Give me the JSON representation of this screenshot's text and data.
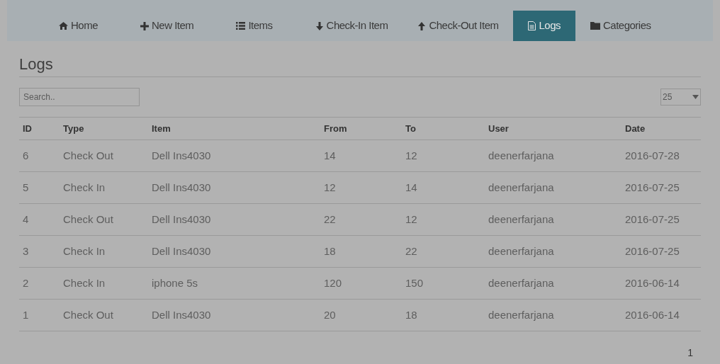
{
  "nav": [
    {
      "label": "Home",
      "selected": false
    },
    {
      "label": "New Item",
      "selected": false
    },
    {
      "label": "Items",
      "selected": false
    },
    {
      "label": "Check-In Item",
      "selected": false
    },
    {
      "label": "Check-Out Item",
      "selected": false
    },
    {
      "label": "Logs",
      "selected": true
    },
    {
      "label": "Categories",
      "selected": false
    }
  ],
  "title": "Logs",
  "search": {
    "placeholder": "Search.."
  },
  "page_size": "25",
  "table": {
    "columns": [
      "ID",
      "Type",
      "Item",
      "From",
      "To",
      "User",
      "Date"
    ],
    "rows": [
      [
        "6",
        "Check Out",
        "Dell Ins4030",
        "14",
        "12",
        "deenerfarjana",
        "2016-07-28"
      ],
      [
        "5",
        "Check In",
        "Dell Ins4030",
        "12",
        "14",
        "deenerfarjana",
        "2016-07-25"
      ],
      [
        "4",
        "Check Out",
        "Dell Ins4030",
        "22",
        "12",
        "deenerfarjana",
        "2016-07-25"
      ],
      [
        "3",
        "Check In",
        "Dell Ins4030",
        "18",
        "22",
        "deenerfarjana",
        "2016-07-25"
      ],
      [
        "2",
        "Check In",
        "iphone 5s",
        "120",
        "150",
        "deenerfarjana",
        "2016-06-14"
      ],
      [
        "1",
        "Check Out",
        "Dell Ins4030",
        "20",
        "18",
        "deenerfarjana",
        "2016-06-14"
      ]
    ]
  },
  "pagination": [
    "1"
  ]
}
